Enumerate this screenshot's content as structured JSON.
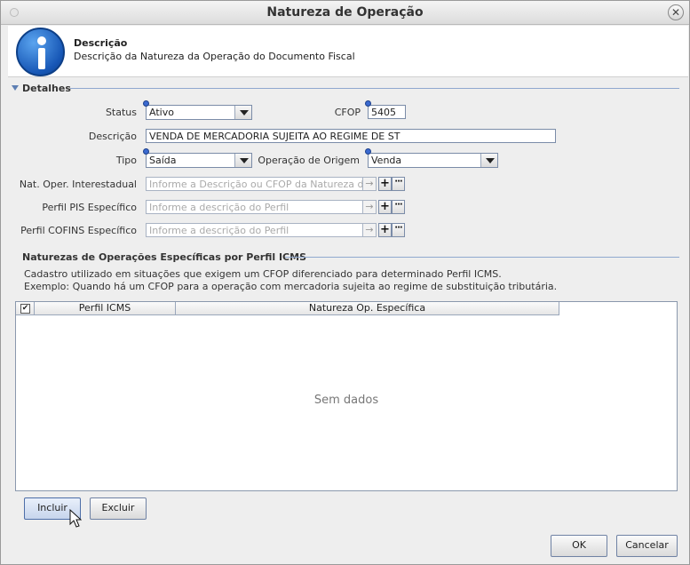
{
  "window": {
    "title": "Natureza de Operação",
    "close_label": "✕"
  },
  "header": {
    "title": "Descrição",
    "subtitle": "Descrição da Natureza da Operação do Documento Fiscal",
    "icon": "info-icon"
  },
  "details_section": {
    "title": "Detalhes",
    "status": {
      "label": "Status",
      "value": "Ativo"
    },
    "cfop": {
      "label": "CFOP",
      "value": "5405"
    },
    "descricao": {
      "label": "Descrição",
      "value": "VENDA DE MERCADORIA SUJEITA AO REGIME DE ST"
    },
    "tipo": {
      "label": "Tipo",
      "value": "Saída"
    },
    "operacao_origem": {
      "label": "Operação de Origem",
      "value": "Venda"
    },
    "nat_interestadual": {
      "label": "Nat. Oper. Interestadual",
      "placeholder": "Informe a Descrição ou CFOP da Natureza de"
    },
    "perfil_pis": {
      "label": "Perfil PIS Específico",
      "placeholder": "Informe a descrição do Perfil"
    },
    "perfil_cofins": {
      "label": "Perfil COFINS Específico",
      "placeholder": "Informe a descrição do Perfil"
    },
    "add_symbol": "+",
    "more_symbol": "···",
    "go_symbol": "→"
  },
  "icms_section": {
    "title": "Naturezas de Operações Específicas por Perfil ICMS",
    "help_line1": "Cadastro utilizado em situações que exigem um CFOP diferenciado para determinado Perfil ICMS.",
    "help_line2": "Exemplo: Quando há um CFOP para a operação com mercadoria sujeita ao regime de substituição tributária.",
    "table": {
      "checkbox_mark": "✔",
      "columns": [
        "Perfil ICMS",
        "Natureza Op. Específica"
      ],
      "empty_text": "Sem dados"
    }
  },
  "buttons": {
    "incluir": "Incluir",
    "excluir": "Excluir",
    "ok": "OK",
    "cancelar": "Cancelar"
  }
}
